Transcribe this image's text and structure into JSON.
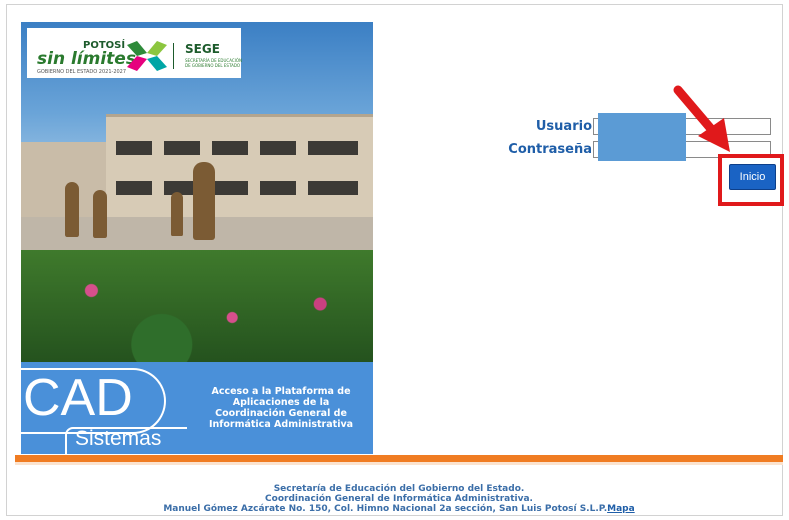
{
  "brand": {
    "potosi": "POTOSÍ",
    "sin_limites": "sin límites",
    "gobierno": "GOBIERNO DEL ESTADO 2021-2027",
    "sege": "SEGE",
    "sege_sub": "SECRETARÍA DE EDUCACIÓN DE GOBIERNO DEL ESTADO"
  },
  "panel": {
    "cad": "CAD",
    "sistemas": "Sistemas",
    "acceso": "Acceso a la Plataforma de Aplicaciones de la Coordinación General de Informática Administrativa"
  },
  "login": {
    "usuario_label": "Usuario",
    "password_label": "Contraseña",
    "usuario_value": "",
    "password_value": "",
    "button_label": "Inicio"
  },
  "footer": {
    "line1": "Secretaría de Educación del Gobierno del Estado.",
    "line2": "Coordinación General de Informática Administrativa.",
    "line3": "Manuel Gómez Azcárate No. 150, Col. Himno Nacional 2a sección, San Luis Potosí S.L.P.",
    "map_link": "Mapa"
  },
  "colors": {
    "accent_blue": "#1a63c4",
    "label_blue": "#1f5ea8",
    "panel_blue": "#4a90d9",
    "highlight_red": "#e0191b",
    "stripe_orange": "#f07c22"
  }
}
